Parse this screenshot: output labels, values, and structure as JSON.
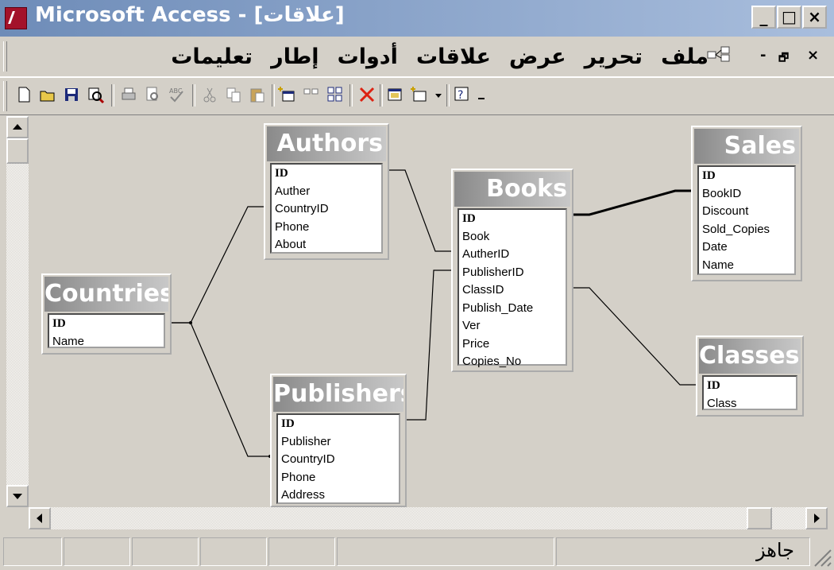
{
  "window": {
    "app_name": "Microsoft Access",
    "document_title": "[علاقات]",
    "title_full": "Microsoft Access - [علاقات]"
  },
  "menu": {
    "items": [
      "ملف",
      "تحرير",
      "عرض",
      "علاقات",
      "أدوات",
      "إطار",
      "تعليمات"
    ],
    "mdi_minimize": "-",
    "mdi_restore": "🗗",
    "mdi_close": "×"
  },
  "toolbar": {
    "buttons": [
      "new-icon",
      "open-icon",
      "save-icon",
      "search-icon",
      "print-icon",
      "print-preview-icon",
      "spelling-icon",
      "cut-icon",
      "copy-icon",
      "paste-icon",
      "show-table-icon",
      "show-direct-icon",
      "show-all-icon",
      "delete-icon",
      "database-window-icon",
      "new-object-icon",
      "help-icon"
    ]
  },
  "tables": {
    "countries": {
      "title": "Countries",
      "fields": [
        "ID",
        "Name"
      ]
    },
    "authors": {
      "title": "Authors",
      "fields": [
        "ID",
        "Auther",
        "CountryID",
        "Phone",
        "About"
      ]
    },
    "publishers": {
      "title": "Publishers",
      "fields": [
        "ID",
        "Publisher",
        "CountryID",
        "Phone",
        "Address"
      ]
    },
    "books": {
      "title": "Books",
      "fields": [
        "ID",
        "Book",
        "AutherID",
        "PublisherID",
        "ClassID",
        "Publish_Date",
        "Ver",
        "Price",
        "Copies_No"
      ]
    },
    "sales": {
      "title": "Sales",
      "fields": [
        "ID",
        "BookID",
        "Discount",
        "Sold_Copies",
        "Date",
        "Name"
      ]
    },
    "classes": {
      "title": "Classes",
      "fields": [
        "ID",
        "Class"
      ]
    }
  },
  "status": {
    "text": "جاهز"
  }
}
